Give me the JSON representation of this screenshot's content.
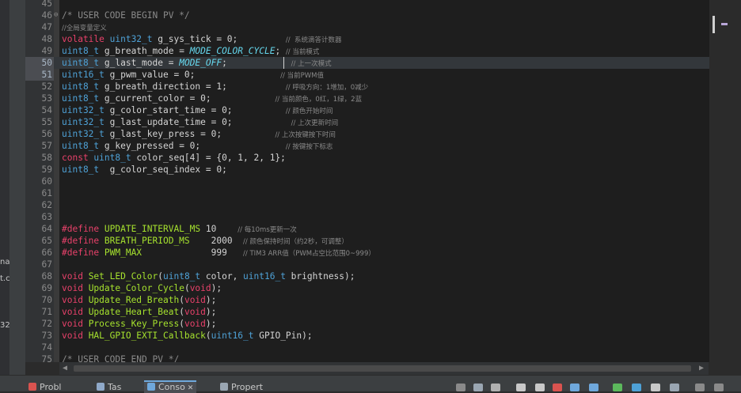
{
  "left_fragments": [
    "na",
    "t.c",
    "32"
  ],
  "lines": [
    {
      "n": "45",
      "segs": []
    },
    {
      "n": "46",
      "fold": "⊖",
      "segs": [
        {
          "t": "/* USER CODE BEGIN PV */",
          "c": "cm"
        }
      ]
    },
    {
      "n": "47",
      "segs": [
        {
          "t": "//全局变量定义",
          "c": "cm-sm"
        }
      ]
    },
    {
      "n": "48",
      "segs": [
        {
          "t": "volatile ",
          "c": "kw"
        },
        {
          "t": "uint32_t",
          "c": "ty"
        },
        {
          "t": " g_sys_tick = 0;         "
        },
        {
          "t": "//  系统滴答计数器",
          "c": "cm-sm"
        }
      ]
    },
    {
      "n": "49",
      "segs": [
        {
          "t": "uint8_t",
          "c": "ty"
        },
        {
          "t": " g_breath_mode = "
        },
        {
          "t": "MODE_COLOR_CYCLE",
          "c": "en"
        },
        {
          "t": "; "
        },
        {
          "t": "// 当前模式",
          "c": "cm-sm"
        }
      ]
    },
    {
      "n": "50",
      "cur": true,
      "segs": [
        {
          "t": "uint8_t",
          "c": "ty"
        },
        {
          "t": " g_last_mode = "
        },
        {
          "t": "MODE_OFF",
          "c": "en"
        },
        {
          "t": ";            "
        },
        {
          "t": "// 上一次模式",
          "c": "cm-sm"
        }
      ]
    },
    {
      "n": "51",
      "hl": true,
      "segs": [
        {
          "t": "uint16_t",
          "c": "ty"
        },
        {
          "t": " g_pwm_value = 0;                "
        },
        {
          "t": "// 当前PWM值",
          "c": "cm-sm"
        }
      ]
    },
    {
      "n": "52",
      "segs": [
        {
          "t": "uint8_t",
          "c": "ty"
        },
        {
          "t": " g_breath_direction = 1;           "
        },
        {
          "t": "// 呼吸方向：1增加，0减少",
          "c": "cm-sm"
        }
      ]
    },
    {
      "n": "53",
      "segs": [
        {
          "t": "uint8_t",
          "c": "ty"
        },
        {
          "t": " g_current_color = 0;            "
        },
        {
          "t": "// 当前颜色，0红，1绿，2蓝",
          "c": "cm-sm"
        }
      ]
    },
    {
      "n": "54",
      "segs": [
        {
          "t": "uint32_t",
          "c": "ty"
        },
        {
          "t": " g_color_start_time = 0;          "
        },
        {
          "t": "// 颜色开始时间",
          "c": "cm-sm"
        }
      ]
    },
    {
      "n": "55",
      "segs": [
        {
          "t": "uint32_t",
          "c": "ty"
        },
        {
          "t": " g_last_update_time = 0;           "
        },
        {
          "t": "// 上次更新时间",
          "c": "cm-sm"
        }
      ]
    },
    {
      "n": "56",
      "segs": [
        {
          "t": "uint32_t",
          "c": "ty"
        },
        {
          "t": " g_last_key_press = 0;          "
        },
        {
          "t": "// 上次按键按下时间",
          "c": "cm-sm"
        }
      ]
    },
    {
      "n": "57",
      "segs": [
        {
          "t": "uint8_t",
          "c": "ty"
        },
        {
          "t": " g_key_pressed = 0;                "
        },
        {
          "t": "// 按键按下标志",
          "c": "cm-sm"
        }
      ]
    },
    {
      "n": "58",
      "segs": [
        {
          "t": "const ",
          "c": "kw"
        },
        {
          "t": "uint8_t",
          "c": "ty"
        },
        {
          "t": " color_seq[4] = {0, 1, 2, 1};"
        }
      ]
    },
    {
      "n": "59",
      "segs": [
        {
          "t": "uint8_t",
          "c": "ty"
        },
        {
          "t": "  g_color_seq_index = 0;"
        }
      ]
    },
    {
      "n": "60",
      "segs": []
    },
    {
      "n": "61",
      "segs": []
    },
    {
      "n": "62",
      "segs": []
    },
    {
      "n": "63",
      "segs": []
    },
    {
      "n": "64",
      "segs": [
        {
          "t": "#define ",
          "c": "kw"
        },
        {
          "t": "UPDATE_INTERVAL_MS",
          "c": "def"
        },
        {
          "t": " 10    "
        },
        {
          "t": "// 每10ms更新一次",
          "c": "cm-sm"
        }
      ]
    },
    {
      "n": "65",
      "segs": [
        {
          "t": "#define ",
          "c": "kw"
        },
        {
          "t": "BREATH_PERIOD_MS",
          "c": "def"
        },
        {
          "t": "    2000  "
        },
        {
          "t": "// 颜色保持时间（约2秒，可调整）",
          "c": "cm-sm"
        }
      ]
    },
    {
      "n": "66",
      "segs": [
        {
          "t": "#define ",
          "c": "kw"
        },
        {
          "t": "PWM_MAX",
          "c": "def"
        },
        {
          "t": "             999   "
        },
        {
          "t": "// TIM3 ARR值（PWM占空比范围0~999）",
          "c": "cm-sm"
        }
      ]
    },
    {
      "n": "67",
      "segs": []
    },
    {
      "n": "68",
      "segs": [
        {
          "t": "void ",
          "c": "kw"
        },
        {
          "t": "Set_LED_Color",
          "c": "fn"
        },
        {
          "t": "("
        },
        {
          "t": "uint8_t",
          "c": "ty"
        },
        {
          "t": " color, "
        },
        {
          "t": "uint16_t",
          "c": "ty"
        },
        {
          "t": " brightness);"
        }
      ]
    },
    {
      "n": "69",
      "segs": [
        {
          "t": "void ",
          "c": "kw"
        },
        {
          "t": "Update_Color_Cycle",
          "c": "fn"
        },
        {
          "t": "("
        },
        {
          "t": "void",
          "c": "kw"
        },
        {
          "t": ");"
        }
      ]
    },
    {
      "n": "70",
      "segs": [
        {
          "t": "void ",
          "c": "kw"
        },
        {
          "t": "Update_Red_Breath",
          "c": "fn"
        },
        {
          "t": "("
        },
        {
          "t": "void",
          "c": "kw"
        },
        {
          "t": ");"
        }
      ]
    },
    {
      "n": "71",
      "segs": [
        {
          "t": "void ",
          "c": "kw"
        },
        {
          "t": "Update_Heart_Beat",
          "c": "fn"
        },
        {
          "t": "("
        },
        {
          "t": "void",
          "c": "kw"
        },
        {
          "t": ");"
        }
      ]
    },
    {
      "n": "72",
      "segs": [
        {
          "t": "void ",
          "c": "kw"
        },
        {
          "t": "Process_Key_Press",
          "c": "fn"
        },
        {
          "t": "("
        },
        {
          "t": "void",
          "c": "kw"
        },
        {
          "t": ");"
        }
      ]
    },
    {
      "n": "73",
      "segs": [
        {
          "t": "void ",
          "c": "kw"
        },
        {
          "t": "HAL_GPIO_EXTI_Callback",
          "c": "fn"
        },
        {
          "t": "("
        },
        {
          "t": "uint16_t",
          "c": "ty"
        },
        {
          "t": " GPIO_Pin);"
        }
      ]
    },
    {
      "n": "74",
      "segs": []
    },
    {
      "n": "75",
      "segs": [
        {
          "t": "/* USER CODE END PV */",
          "c": "cm"
        }
      ]
    }
  ],
  "bottom_tabs": [
    {
      "label": "Probl",
      "icon": "problems-icon",
      "color": "#d9534f"
    },
    {
      "label": "Tas",
      "icon": "tasks-icon",
      "color": "#8fa9c9"
    },
    {
      "label": "Conso",
      "icon": "console-icon",
      "color": "#6fa8dc",
      "active": true,
      "close": "✕"
    },
    {
      "label": "Propert",
      "icon": "properties-icon",
      "color": "#9aa6b2"
    }
  ],
  "colors": {
    "keyword": "#e8416a",
    "type": "#4ea1d6",
    "function": "#a6e22e",
    "comment": "#8a8a8a",
    "background": "#1e1e1e"
  }
}
